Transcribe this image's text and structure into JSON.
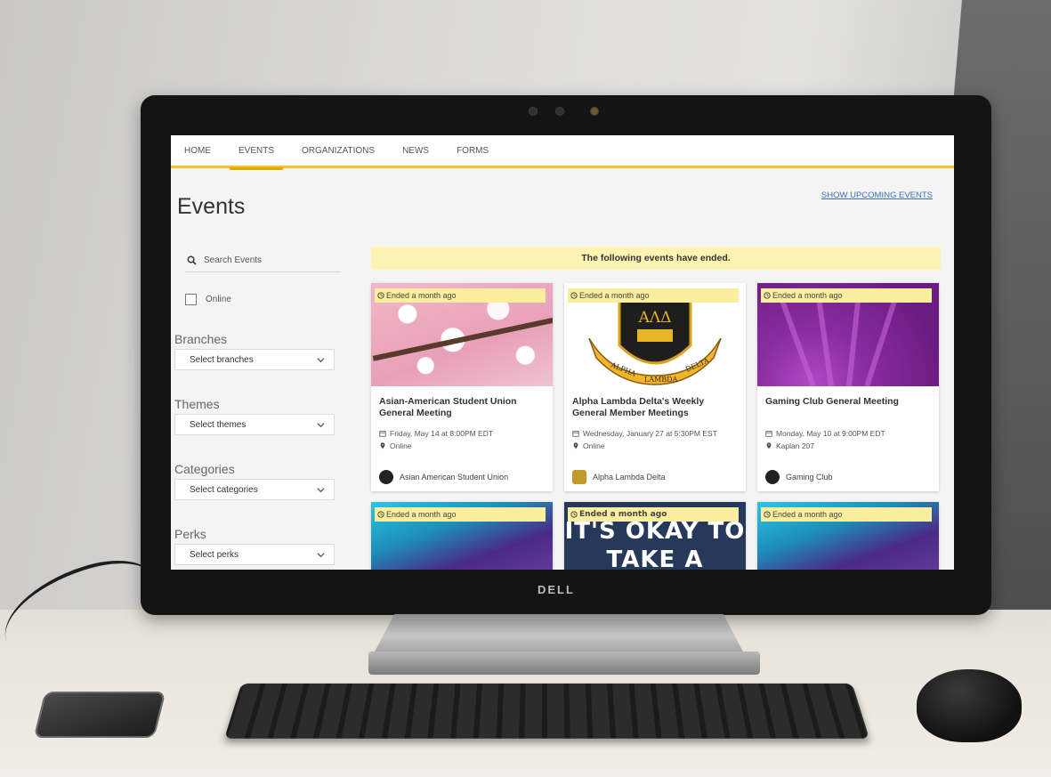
{
  "monitor": {
    "brand": "DELL"
  },
  "nav": {
    "items": [
      "HOME",
      "EVENTS",
      "ORGANIZATIONS",
      "NEWS",
      "FORMS"
    ],
    "active": "EVENTS"
  },
  "page": {
    "title": "Events",
    "upcoming_link": "SHOW UPCOMING EVENTS"
  },
  "filters": {
    "search_placeholder": "Search Events",
    "online_label": "Online",
    "groups": [
      {
        "label": "Branches",
        "placeholder": "Select branches"
      },
      {
        "label": "Themes",
        "placeholder": "Select themes"
      },
      {
        "label": "Categories",
        "placeholder": "Select categories"
      },
      {
        "label": "Perks",
        "placeholder": "Select perks"
      }
    ]
  },
  "results": {
    "banner": "The following events have ended.",
    "events": [
      {
        "tag": "Ended a month ago",
        "title": "Asian-American Student Union General Meeting",
        "date": "Friday, May 14 at 8:00PM EDT",
        "location": "Online",
        "org": "Asian American Student Union"
      },
      {
        "tag": "Ended a month ago",
        "title": "Alpha Lambda Delta's Weekly General Member Meetings",
        "date": "Wednesday, January 27 at 5:30PM EST",
        "location": "Online",
        "org": "Alpha Lambda Delta",
        "crest_letters": "ΑΛΔ",
        "crest_banner_left": "ALPHA",
        "crest_banner_mid": "LAMBDA",
        "crest_banner_right": "DELTA"
      },
      {
        "tag": "Ended a month ago",
        "title": "Gaming Club General Meeting",
        "date": "Monday, May 10 at 9:00PM EDT",
        "location": "Kaplan 207",
        "org": "Gaming Club"
      },
      {
        "tag": "Ended a month ago"
      },
      {
        "tag": "Ended a month ago",
        "poster_line1": "IT'S OKAY TO",
        "poster_line2": "TAKE A"
      },
      {
        "tag": "Ended a month ago"
      }
    ]
  },
  "colors": {
    "accent": "#f1c72b",
    "banner": "#fdf3b2",
    "link": "#3b6fb6"
  }
}
